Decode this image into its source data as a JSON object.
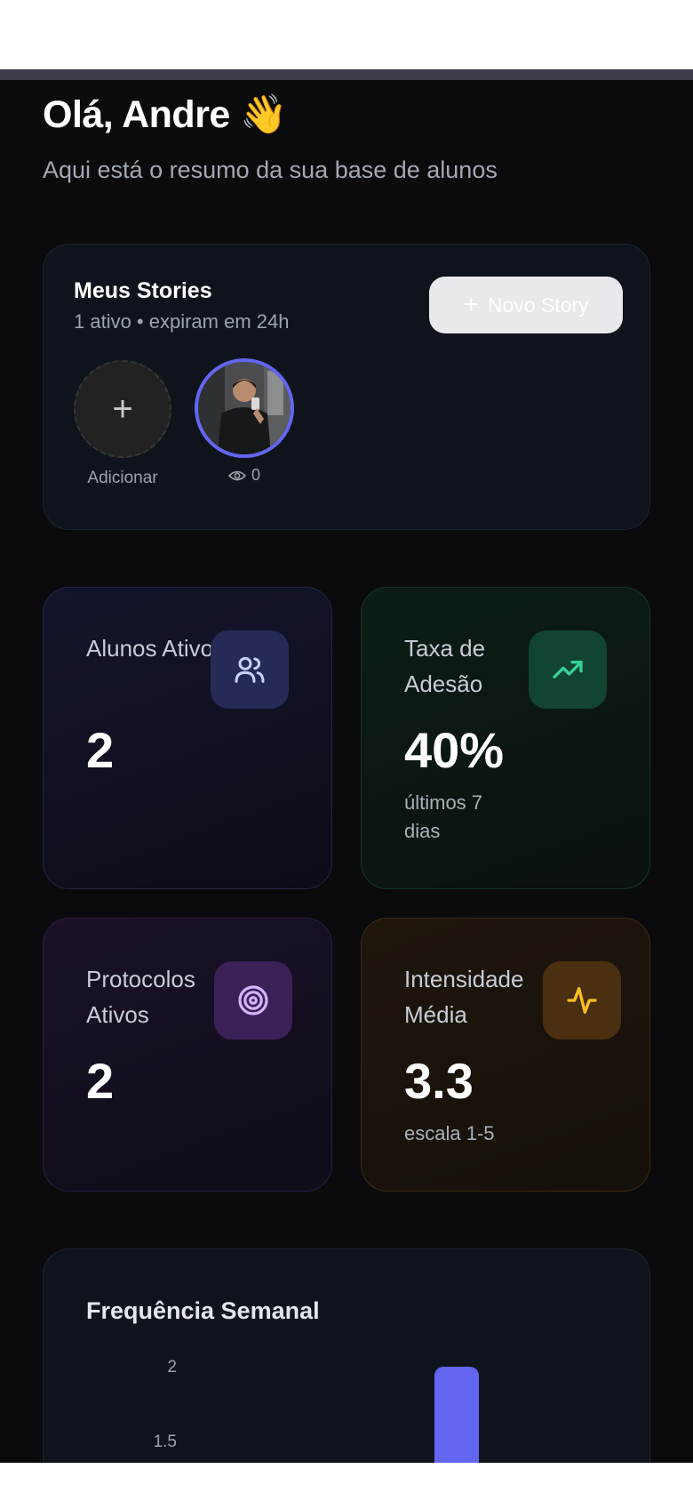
{
  "header": {
    "greeting": "Olá, Andre 👋",
    "subtitle": "Aqui está o resumo da sua base de alunos"
  },
  "stories": {
    "title": "Meus Stories",
    "subtitle": "1 ativo • expiram em 24h",
    "new_story_label": "Novo Story",
    "add_label": "Adicionar",
    "views": "0"
  },
  "stats": [
    {
      "label": "Alunos Ativos",
      "value": "2",
      "note": "",
      "icon": "users-icon",
      "accent": "#818cf8"
    },
    {
      "label": "Taxa de Adesão",
      "value": "40%",
      "note": "últimos 7 dias",
      "icon": "trending-up-icon",
      "accent": "#34d399"
    },
    {
      "label": "Protocolos Ativos",
      "value": "2",
      "note": "",
      "icon": "target-icon",
      "accent": "#c084fc"
    },
    {
      "label": "Intensidade Média",
      "value": "3.3",
      "note": "escala 1-5",
      "icon": "activity-icon",
      "accent": "#fbbf24"
    }
  ],
  "frequency": {
    "title": "Frequência Semanal"
  },
  "chart_data": {
    "type": "bar",
    "yticks": [
      "2",
      "1.5"
    ],
    "values": [
      2
    ],
    "bar_color": "#6366f1"
  }
}
